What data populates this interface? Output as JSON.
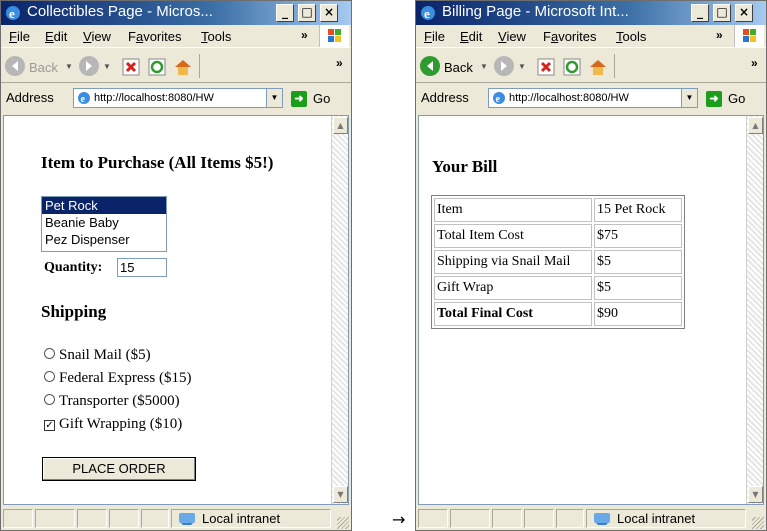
{
  "left_window": {
    "title": "Collectibles Page - Micros...",
    "menu": [
      "File",
      "Edit",
      "View",
      "Favorites",
      "Tools"
    ],
    "menu_overflow": "»",
    "toolbar": {
      "back_label": "Back",
      "overflow": "»"
    },
    "address": {
      "label": "Address",
      "url": "http://localhost:8080/HW",
      "go_label": "Go"
    },
    "status": {
      "zone": "Local intranet"
    },
    "content": {
      "heading": "Item to Purchase (All Items $5!)",
      "items": [
        "Pet Rock",
        "Beanie Baby",
        "Pez Dispenser"
      ],
      "selected_item": "Pet Rock",
      "quantity_label": "Quantity:",
      "quantity_value": "15",
      "shipping_heading": "Shipping",
      "shipping_options": [
        "Snail Mail ($5)",
        "Federal Express ($15)",
        "Transporter ($5000)"
      ],
      "gift_wrap_label": "Gift Wrapping ($10)",
      "gift_wrap_checked": true,
      "submit_label": "PLACE ORDER"
    }
  },
  "right_window": {
    "title": "Billing Page - Microsoft Int...",
    "menu": [
      "File",
      "Edit",
      "View",
      "Favorites",
      "Tools"
    ],
    "menu_overflow": "»",
    "toolbar": {
      "back_label": "Back",
      "overflow": "»"
    },
    "address": {
      "label": "Address",
      "url": "http://localhost:8080/HW",
      "go_label": "Go"
    },
    "status": {
      "zone": "Local intranet"
    },
    "content": {
      "heading": "Your Bill",
      "rows": [
        [
          "Item",
          "15 Pet Rock"
        ],
        [
          "Total Item Cost",
          "$75"
        ],
        [
          "Shipping via Snail Mail",
          "$5"
        ],
        [
          "Gift Wrap",
          "$5"
        ],
        [
          "Total Final Cost",
          "$90"
        ]
      ]
    }
  },
  "transition_arrow": "→",
  "icons": [
    "ie-icon",
    "windows-flag-icon",
    "back-icon",
    "forward-icon",
    "stop-icon",
    "refresh-icon",
    "home-icon",
    "page-icon",
    "go-arrow-icon",
    "intranet-globe-icon"
  ],
  "colors": {
    "titlebar": "#0a246a",
    "selection": "#0a246a",
    "chrome": "#ece9d8"
  }
}
